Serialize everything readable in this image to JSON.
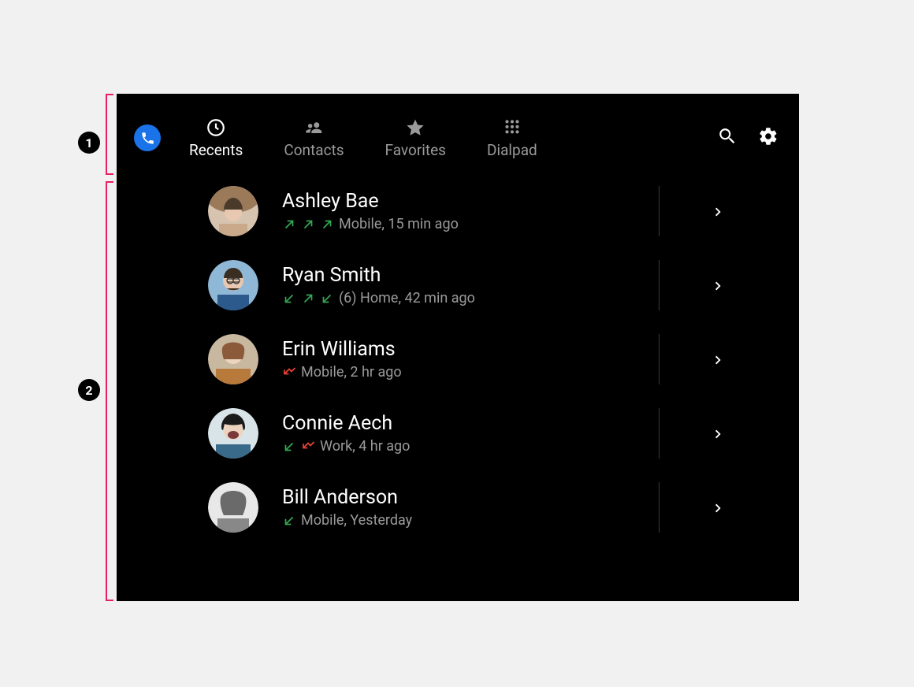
{
  "annotations": {
    "label1": "1",
    "label2": "2"
  },
  "tabs": {
    "recents": "Recents",
    "contacts": "Contacts",
    "favorites": "Favorites",
    "dialpad": "Dialpad"
  },
  "calls": [
    {
      "name": "Ashley Bae",
      "directions": [
        "out",
        "out",
        "out"
      ],
      "count_prefix": "",
      "line": "Mobile",
      "time": "15 min ago"
    },
    {
      "name": "Ryan Smith",
      "directions": [
        "in",
        "out",
        "in"
      ],
      "count_prefix": "(6) ",
      "line": "Home",
      "time": "42 min ago"
    },
    {
      "name": "Erin Williams",
      "directions": [
        "miss"
      ],
      "count_prefix": "",
      "line": "Mobile",
      "time": "2 hr ago"
    },
    {
      "name": "Connie Aech",
      "directions": [
        "in",
        "miss"
      ],
      "count_prefix": "",
      "line": "Work",
      "time": "4 hr ago"
    },
    {
      "name": "Bill Anderson",
      "directions": [
        "in"
      ],
      "count_prefix": "",
      "line": "Mobile",
      "time": "Yesterday"
    }
  ]
}
